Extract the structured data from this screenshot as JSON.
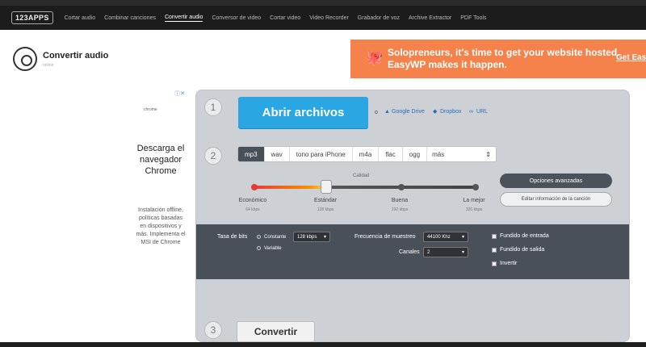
{
  "nav": {
    "logo": "123APPS",
    "items": [
      {
        "label": "Cortar audio",
        "active": false
      },
      {
        "label": "Combinar canciones",
        "active": false
      },
      {
        "label": "Convertir audio",
        "active": true
      },
      {
        "label": "Conversor de video",
        "active": false
      },
      {
        "label": "Cortar video",
        "active": false
      },
      {
        "label": "Video Recorder",
        "active": false
      },
      {
        "label": "Grabador de voz",
        "active": false
      },
      {
        "label": "Archive Extractor",
        "active": false
      },
      {
        "label": "PDF Tools",
        "active": false
      }
    ]
  },
  "app": {
    "title": "Convertir audio",
    "subtitle": "online"
  },
  "banner": {
    "text": "Solopreneurs, it's time to get your website hosted. EasyWP makes it happen.",
    "cta": "Get Easy",
    "bg_color": "#f4824a"
  },
  "side_ad": {
    "logo_text": "chrome",
    "headline": "Descarga el navegador Chrome",
    "body": "Instalación offline, políticas basadas en dispositivos y más. Implementa el MSI de Chrome"
  },
  "step1": {
    "number": "1",
    "open_button": "Abrir archivos",
    "or_text": "o",
    "sources": [
      "Google Drive",
      "Dropbox",
      "URL"
    ]
  },
  "step2": {
    "number": "2",
    "formats": [
      "mp3",
      "wav",
      "tono para iPhone",
      "m4a",
      "flac",
      "ogg"
    ],
    "active_format": "mp3",
    "more_label": "más",
    "quality": {
      "label": "Calidad",
      "levels": [
        {
          "name": "Económico",
          "rate": "64 kbps"
        },
        {
          "name": "Estándar",
          "rate": "128 kbps"
        },
        {
          "name": "Buena",
          "rate": "192 kbps"
        },
        {
          "name": "La mejor",
          "rate": "320 kbps"
        }
      ],
      "selected": "Estándar"
    },
    "advanced_button": "Opciones avanzadas",
    "edit_button": "Editar información de la canción",
    "advanced": {
      "bitrate_label": "Tasa de bits",
      "bitrate_constant": "Constante",
      "bitrate_variable": "Variable",
      "bitrate_mode": "Constante",
      "bitrate_value": "128 kbps",
      "sample_rate_label": "Frecuencia de muestreo",
      "sample_rate_value": "44100 Khz",
      "channels_label": "Canales",
      "channels_value": "2",
      "options": [
        "Fundido de entrada",
        "Fundido de salida",
        "Invertir"
      ]
    }
  },
  "step3": {
    "number": "3",
    "convert_button": "Convertir"
  }
}
